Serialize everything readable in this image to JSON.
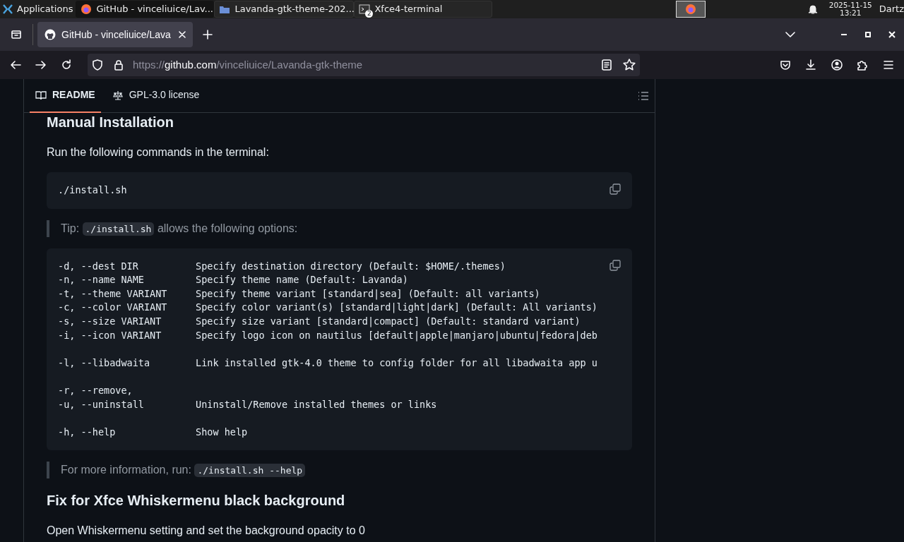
{
  "taskbar": {
    "apps_menu": "Applications",
    "tasks": [
      {
        "title": "GitHub - vinceliuice/Lav...",
        "kind": "browser",
        "selected": true
      },
      {
        "title": "Lavanda-gtk-theme-202...",
        "kind": "folder",
        "selected": false
      },
      {
        "title": "Xfce4-terminal",
        "kind": "terminal",
        "selected": false,
        "badge": "2"
      }
    ],
    "date": "2025-11-15",
    "time": "13:21",
    "user": "Dartz"
  },
  "browser": {
    "tabs": [
      {
        "title": "GitHub - vinceliuice/Lava",
        "selected": true
      }
    ],
    "url": {
      "scheme": "https://",
      "domain": "github.com",
      "path": "/vinceliuice/Lavanda-gtk-theme"
    }
  },
  "readme": {
    "tabs": [
      {
        "label": "README",
        "kind": "book",
        "selected": true
      },
      {
        "label": "GPL-3.0 license",
        "kind": "scale",
        "selected": false
      }
    ],
    "content": [
      {
        "kind": "heading",
        "text": "Manual Installation"
      },
      {
        "kind": "paragraph",
        "text": "Run the following commands in the terminal:"
      },
      {
        "kind": "code",
        "groups": [
          [
            "./install.sh"
          ]
        ]
      },
      {
        "kind": "quote",
        "parts": [
          "Tip: ",
          "./install.sh",
          " allows the following options:"
        ]
      },
      {
        "kind": "code",
        "groups": [
          [
            "-d, --dest DIR          Specify destination directory (Default: $HOME/.themes)",
            "-n, --name NAME         Specify theme name (Default: Lavanda)",
            "-t, --theme VARIANT     Specify theme variant [standard|sea] (Default: all variants)",
            "-c, --color VARIANT     Specify color variant(s) [standard|light|dark] (Default: All variants)",
            "-s, --size VARIANT      Specify size variant [standard|compact] (Default: standard variant)",
            "-i, --icon VARIANT      Specify logo icon on nautilus [default|apple|manjaro|ubuntu|fedora|deb"
          ],
          [
            "-l, --libadwaita        Link installed gtk-4.0 theme to config folder for all libadwaita app u"
          ],
          [
            "-r, --remove,",
            "-u, --uninstall         Uninstall/Remove installed themes or links"
          ],
          [
            "-h, --help              Show help"
          ]
        ]
      },
      {
        "kind": "quote",
        "parts": [
          "For more information, run: ",
          "./install.sh --help"
        ]
      },
      {
        "kind": "heading",
        "text": "Fix for Xfce Whiskermenu black background"
      },
      {
        "kind": "paragraph",
        "text": "Open Whiskermenu setting and set the background opacity to 0"
      }
    ]
  }
}
